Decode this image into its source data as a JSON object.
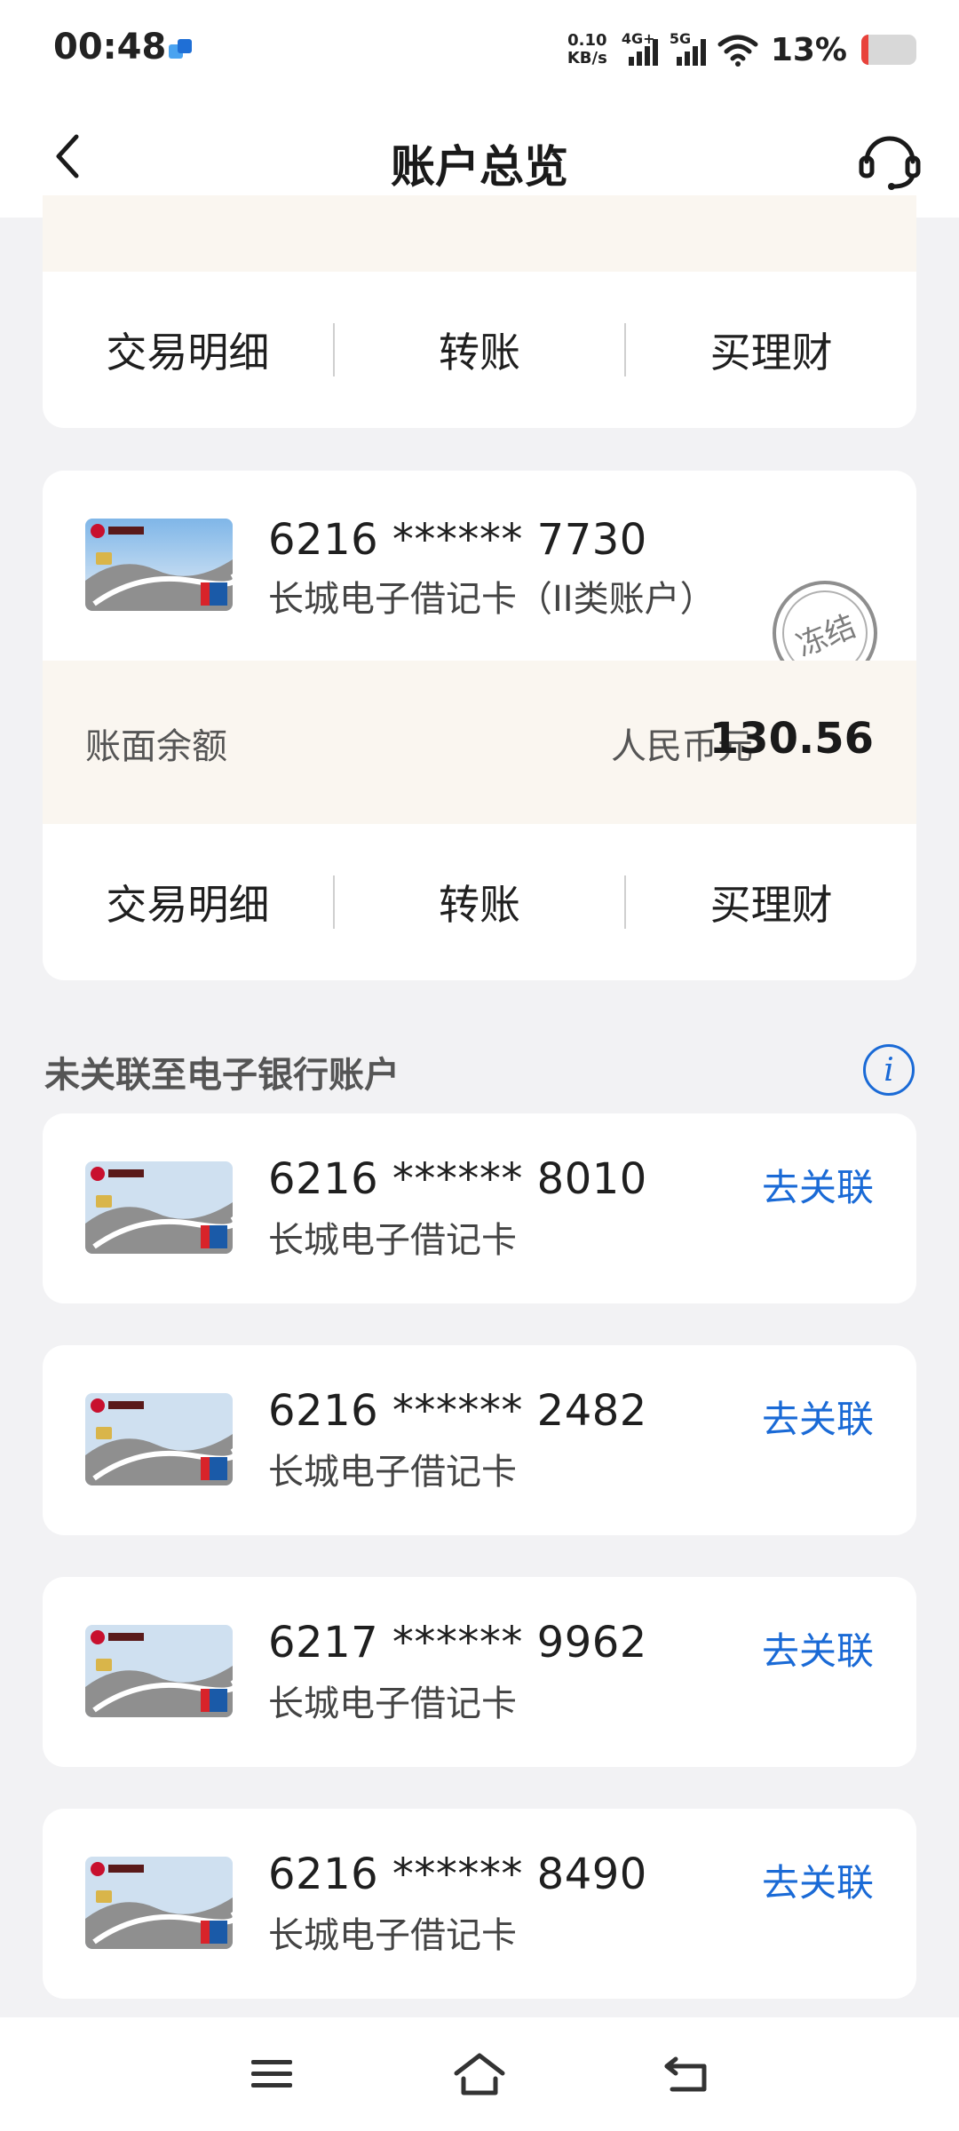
{
  "status_bar": {
    "time": "00:48",
    "net_speed_value": "0.10",
    "net_speed_unit": "KB/s",
    "signal1": "4G+",
    "signal2": "5G",
    "battery_pct": "13%",
    "battery_level": 0.13,
    "battery_color": "#e8423b"
  },
  "header": {
    "title": "账户总览",
    "back_icon": "chevron-left-icon",
    "service_icon": "headset-icon"
  },
  "colors": {
    "accent": "#1a6ad6",
    "balance_bg": "#faf6f0",
    "page_bg": "#f2f2f4"
  },
  "top_card": {
    "actions": [
      "交易明细",
      "转账",
      "买理财"
    ]
  },
  "linked_card": {
    "number": "6216 ****** 7730",
    "type": "长城电子借记卡（II类账户）",
    "status_stamp": "冻结",
    "balance_label": "账面余额",
    "currency": "人民币元",
    "amount": "130.56",
    "actions": [
      "交易明细",
      "转账",
      "买理财"
    ]
  },
  "unlinked_section": {
    "title": "未关联至电子银行账户",
    "info_icon": "i",
    "link_label": "去关联",
    "cards": [
      {
        "number": "6216 ****** 8010",
        "type": "长城电子借记卡"
      },
      {
        "number": "6216 ****** 2482",
        "type": "长城电子借记卡"
      },
      {
        "number": "6217 ****** 9962",
        "type": "长城电子借记卡"
      },
      {
        "number": "6216 ****** 8490",
        "type": "长城电子借记卡"
      }
    ]
  },
  "nav": {
    "menu_icon": "menu-icon",
    "home_icon": "home-icon",
    "back_icon": "back-icon"
  }
}
